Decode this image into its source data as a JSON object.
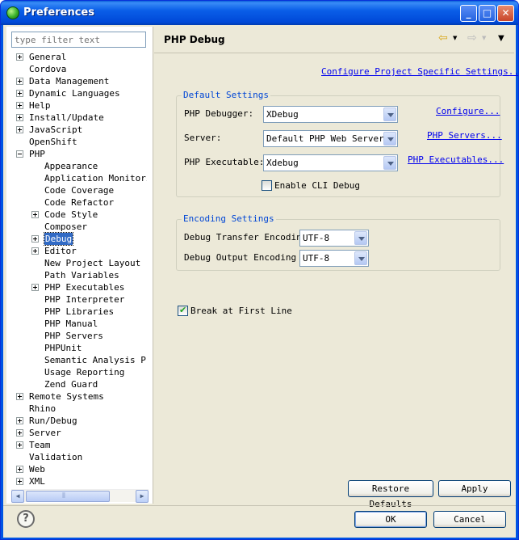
{
  "window": {
    "title": "Preferences",
    "minimize": "_",
    "maximize": "□",
    "close": "✕"
  },
  "filter": {
    "placeholder": "type filter text"
  },
  "tree": [
    {
      "label": "General",
      "level": 0,
      "toggle": "plus"
    },
    {
      "label": "Cordova",
      "level": 0,
      "toggle": "none"
    },
    {
      "label": "Data Management",
      "level": 0,
      "toggle": "plus"
    },
    {
      "label": "Dynamic Languages",
      "level": 0,
      "toggle": "plus"
    },
    {
      "label": "Help",
      "level": 0,
      "toggle": "plus"
    },
    {
      "label": "Install/Update",
      "level": 0,
      "toggle": "plus"
    },
    {
      "label": "JavaScript",
      "level": 0,
      "toggle": "plus"
    },
    {
      "label": "OpenShift",
      "level": 0,
      "toggle": "none"
    },
    {
      "label": "PHP",
      "level": 0,
      "toggle": "minus"
    },
    {
      "label": "Appearance",
      "level": 1,
      "toggle": "none"
    },
    {
      "label": "Application Monitorir",
      "level": 1,
      "toggle": "none"
    },
    {
      "label": "Code Coverage",
      "level": 1,
      "toggle": "none"
    },
    {
      "label": "Code Refactor",
      "level": 1,
      "toggle": "none"
    },
    {
      "label": "Code Style",
      "level": 1,
      "toggle": "plus"
    },
    {
      "label": "Composer",
      "level": 1,
      "toggle": "none"
    },
    {
      "label": "Debug",
      "level": 1,
      "toggle": "plus",
      "selected": true
    },
    {
      "label": "Editor",
      "level": 1,
      "toggle": "plus"
    },
    {
      "label": "New Project Layout",
      "level": 1,
      "toggle": "none"
    },
    {
      "label": "Path Variables",
      "level": 1,
      "toggle": "none"
    },
    {
      "label": "PHP Executables",
      "level": 1,
      "toggle": "plus"
    },
    {
      "label": "PHP Interpreter",
      "level": 1,
      "toggle": "none"
    },
    {
      "label": "PHP Libraries",
      "level": 1,
      "toggle": "none"
    },
    {
      "label": "PHP Manual",
      "level": 1,
      "toggle": "none"
    },
    {
      "label": "PHP Servers",
      "level": 1,
      "toggle": "none"
    },
    {
      "label": "PHPUnit",
      "level": 1,
      "toggle": "none"
    },
    {
      "label": "Semantic Analysis Pro",
      "level": 1,
      "toggle": "none"
    },
    {
      "label": "Usage Reporting",
      "level": 1,
      "toggle": "none"
    },
    {
      "label": "Zend Guard",
      "level": 1,
      "toggle": "none"
    },
    {
      "label": "Remote Systems",
      "level": 0,
      "toggle": "plus"
    },
    {
      "label": "Rhino",
      "level": 0,
      "toggle": "none"
    },
    {
      "label": "Run/Debug",
      "level": 0,
      "toggle": "plus"
    },
    {
      "label": "Server",
      "level": 0,
      "toggle": "plus"
    },
    {
      "label": "Team",
      "level": 0,
      "toggle": "plus"
    },
    {
      "label": "Validation",
      "level": 0,
      "toggle": "none"
    },
    {
      "label": "Web",
      "level": 0,
      "toggle": "plus"
    },
    {
      "label": "XML",
      "level": 0,
      "toggle": "plus"
    }
  ],
  "page": {
    "title": "PHP Debug",
    "back_icon": "⇦",
    "forward_icon": "⇨",
    "menu_icon": "▼",
    "configure_project_link": "Configure Project Specific Settings..."
  },
  "default_settings": {
    "legend": "Default Settings",
    "debugger_label": "PHP Debugger:",
    "debugger_value": "XDebug",
    "configure_link": "Configure...",
    "server_label": "Server:",
    "server_value": "Default PHP Web Server",
    "servers_link": "PHP Servers...",
    "executable_label": "PHP Executable:",
    "executable_value": "Xdebug",
    "executables_link": "PHP Executables...",
    "cli_debug_label": "Enable CLI Debug",
    "cli_debug_checked": false
  },
  "encoding_settings": {
    "legend": "Encoding Settings",
    "transfer_label": "Debug Transfer Encoding",
    "transfer_value": "UTF-8",
    "output_label": "Debug Output Encoding",
    "output_value": "UTF-8"
  },
  "break_first_line": {
    "label": "Break at First Line",
    "checked": true
  },
  "buttons": {
    "restore_defaults": "Restore Defaults",
    "apply": "Apply",
    "ok": "OK",
    "cancel": "Cancel",
    "help_icon": "?"
  },
  "colors": {
    "title_bar": "#0054e3",
    "selection": "#316ac5",
    "link": "#0000ee",
    "group_legend": "#0046d5"
  }
}
